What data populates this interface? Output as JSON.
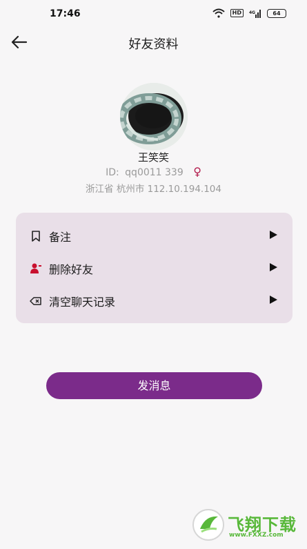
{
  "status_bar": {
    "time": "17:46",
    "hd": "HD",
    "signal": "4G",
    "battery": "64"
  },
  "header": {
    "title": "好友资料",
    "back_icon": "arrow-left-icon"
  },
  "profile": {
    "name": "王笑笑",
    "id_label": "ID:",
    "id_value": "qq0011 339",
    "gender_symbol": "♀",
    "location": "浙江省 杭州市 112.10.194.104"
  },
  "menu": {
    "items": [
      {
        "label": "备注",
        "icon": "bookmark-icon"
      },
      {
        "label": "删除好友",
        "icon": "remove-user-icon"
      },
      {
        "label": "清空聊天记录",
        "icon": "clear-icon"
      }
    ]
  },
  "actions": {
    "send_message": "发消息"
  },
  "watermark": {
    "title": "飞翔下载",
    "url": "www.FXXZ.com"
  },
  "colors": {
    "accent": "#7b2b8a",
    "card": "#e9dfe8",
    "gender": "#b21a4b",
    "watermark": "#58b83a"
  }
}
